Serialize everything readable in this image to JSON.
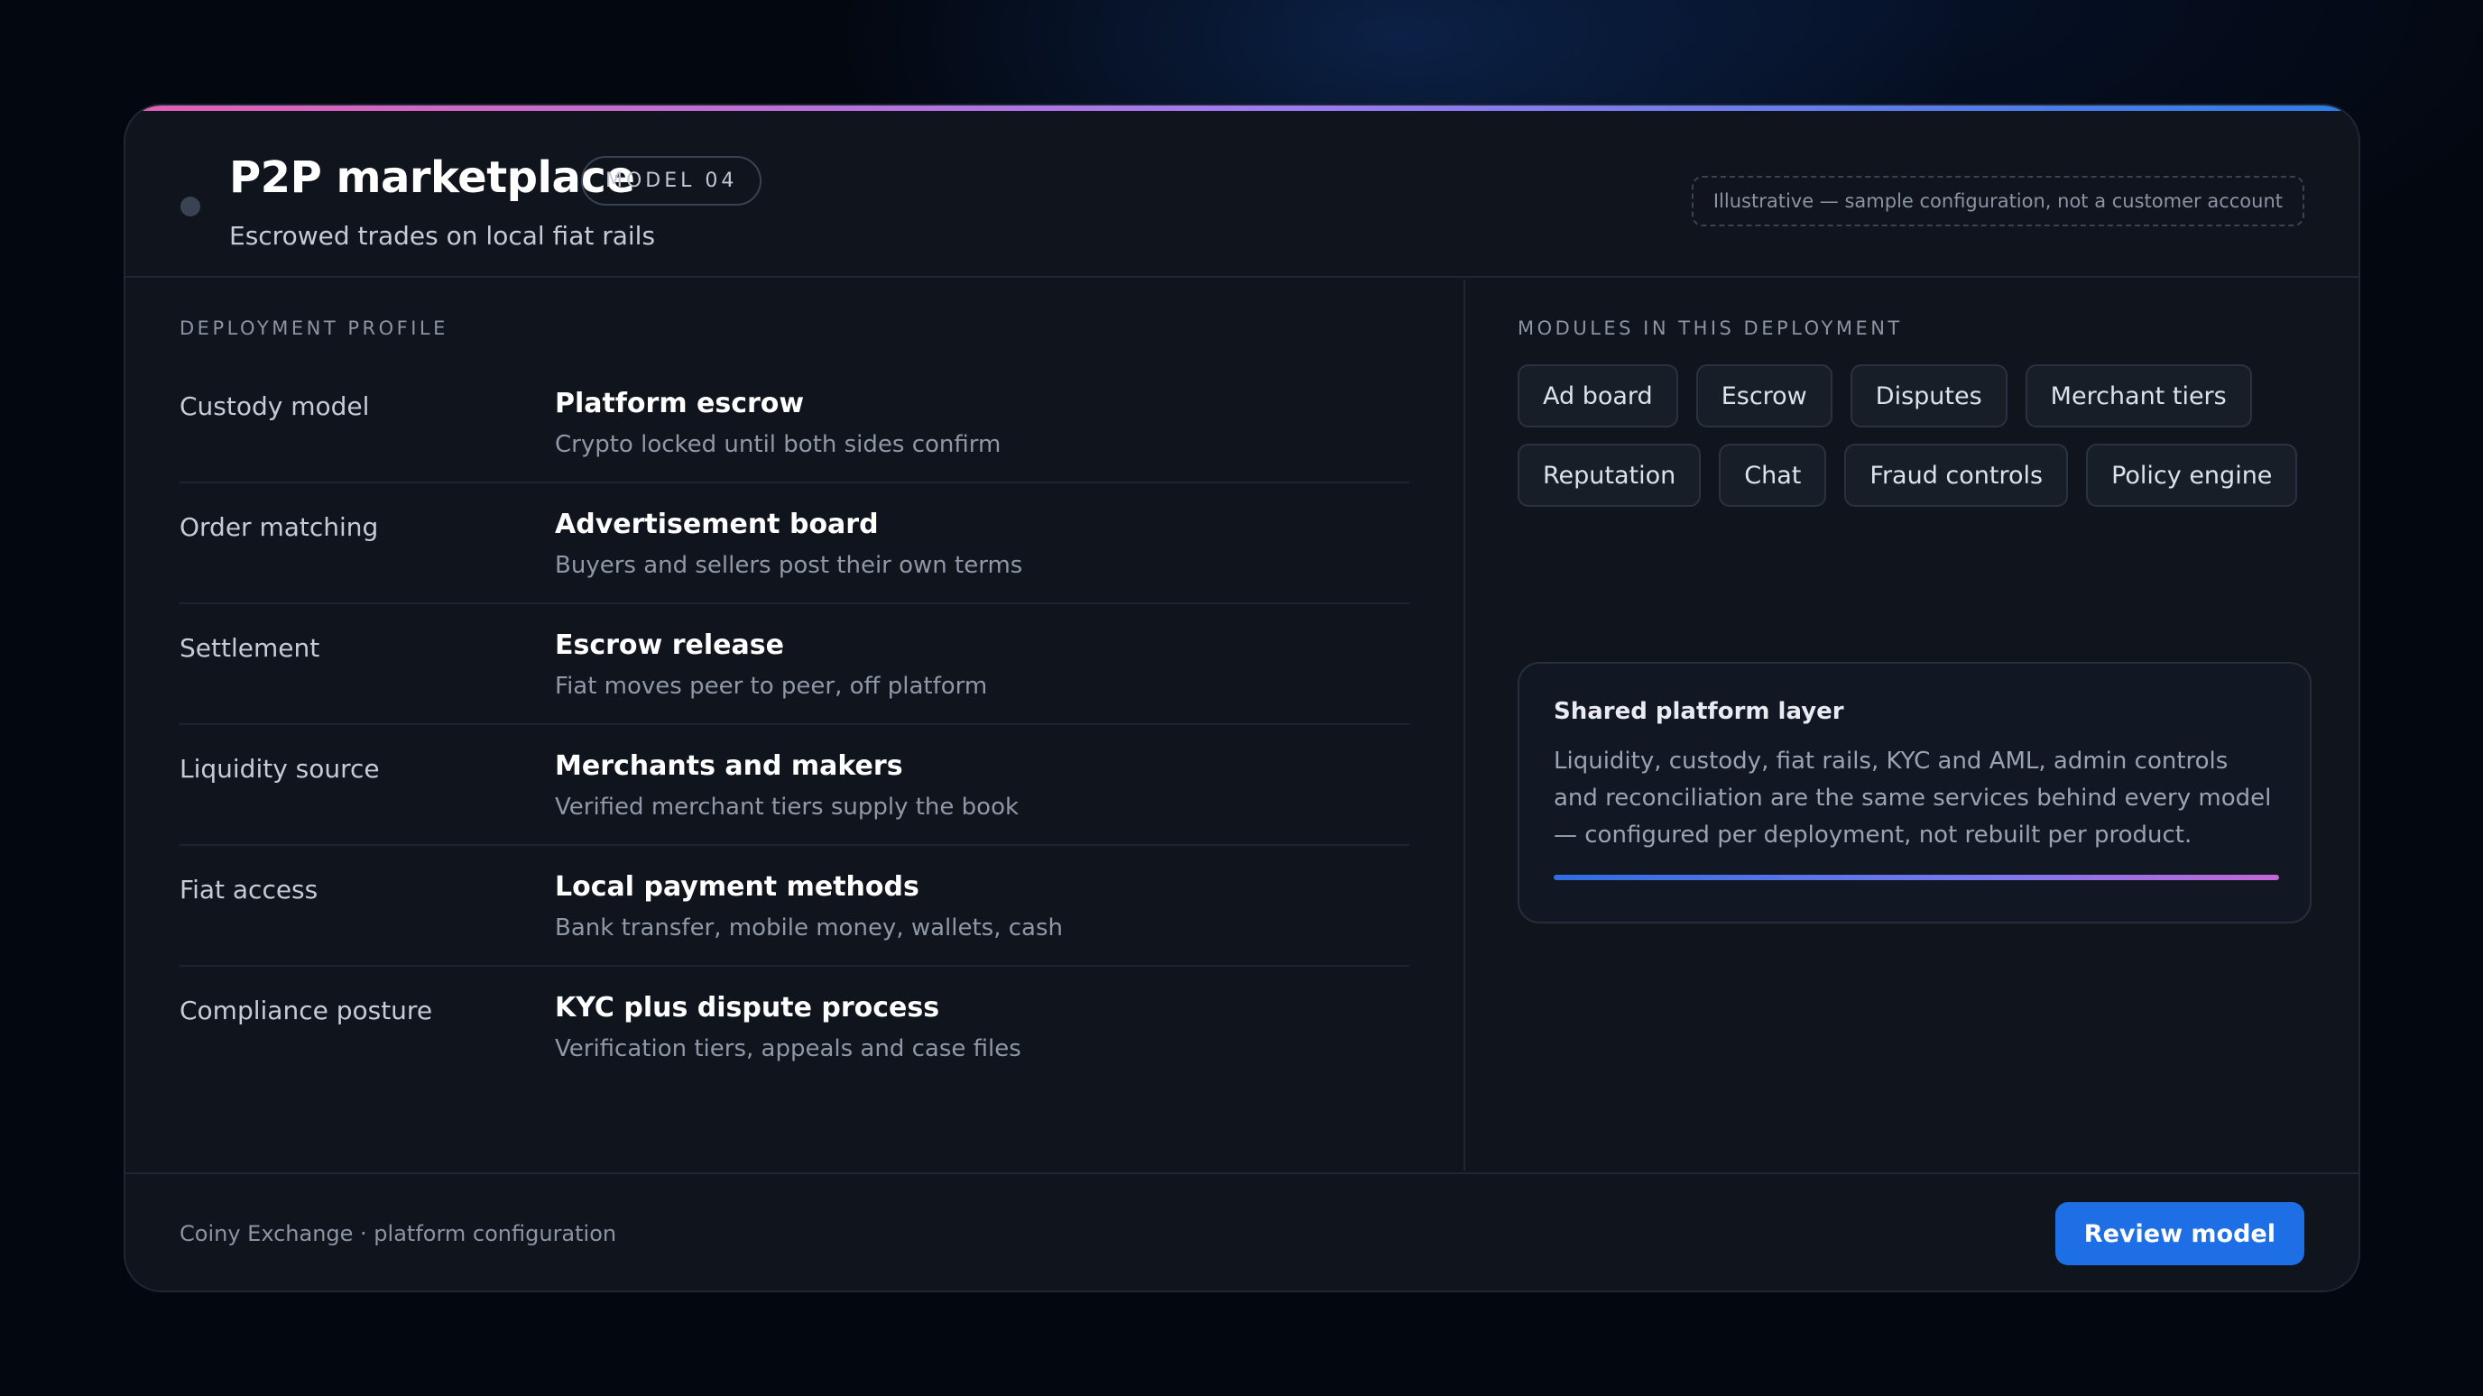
{
  "header": {
    "title": "P2P marketplace",
    "model_badge": "MODEL 04",
    "subtitle": "Escrowed trades on local fiat rails",
    "note": "Illustrative — sample configuration, not a customer account"
  },
  "profile": {
    "section_label": "DEPLOYMENT PROFILE",
    "rows": [
      {
        "key": "Custody model",
        "value": "Platform escrow",
        "desc": "Crypto locked until both sides confirm"
      },
      {
        "key": "Order matching",
        "value": "Advertisement board",
        "desc": "Buyers and sellers post their own terms"
      },
      {
        "key": "Settlement",
        "value": "Escrow release",
        "desc": "Fiat moves peer to peer, off platform"
      },
      {
        "key": "Liquidity source",
        "value": "Merchants and makers",
        "desc": "Verified merchant tiers supply the book"
      },
      {
        "key": "Fiat access",
        "value": "Local payment methods",
        "desc": "Bank transfer, mobile money, wallets, cash"
      },
      {
        "key": "Compliance posture",
        "value": "KYC plus dispute process",
        "desc": "Verification tiers, appeals and case files"
      }
    ]
  },
  "modules": {
    "section_label": "MODULES IN THIS DEPLOYMENT",
    "chips": [
      "Ad board",
      "Escrow",
      "Disputes",
      "Merchant tiers",
      "Reputation",
      "Chat",
      "Fraud controls",
      "Policy engine"
    ]
  },
  "shared_layer": {
    "title": "Shared platform layer",
    "body": "Liquidity, custody, fiat rails, KYC and AML, admin controls and reconciliation are the same services behind every model — configured per deployment, not rebuilt per product."
  },
  "footer": {
    "text": "Coiny Exchange · platform configuration",
    "button_label": "Review model"
  },
  "colors": {
    "accent": "#1e6fe6",
    "background": "#03070f",
    "card": "#0f141d"
  }
}
